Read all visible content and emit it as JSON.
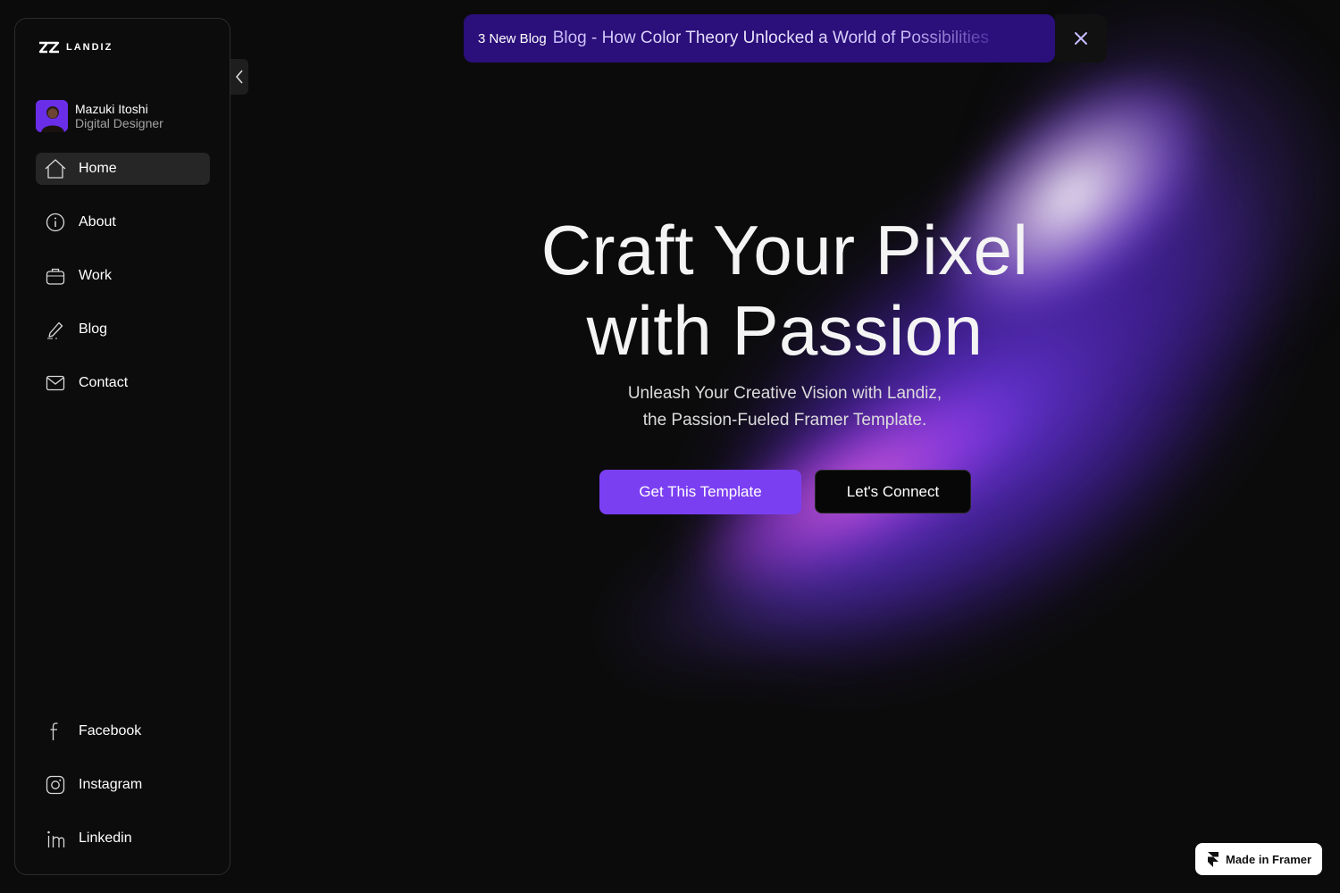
{
  "brand": {
    "logo_mark": "LZ",
    "logo_text": "LANDIZ"
  },
  "profile": {
    "name": "Mazuki Itoshi",
    "role": "Digital Designer"
  },
  "nav": {
    "items": [
      {
        "label": "Home",
        "icon": "home-icon",
        "active": true
      },
      {
        "label": "About",
        "icon": "info-icon",
        "active": false
      },
      {
        "label": "Work",
        "icon": "briefcase-icon",
        "active": false
      },
      {
        "label": "Blog",
        "icon": "pen-icon",
        "active": false
      },
      {
        "label": "Contact",
        "icon": "mail-icon",
        "active": false
      }
    ]
  },
  "social": {
    "items": [
      {
        "label": "Facebook",
        "icon": "facebook-icon"
      },
      {
        "label": "Instagram",
        "icon": "instagram-icon"
      },
      {
        "label": "Linkedin",
        "icon": "linkedin-icon"
      }
    ]
  },
  "banner": {
    "tag": "3 New Blog",
    "text": "Blog - How Color Theory Unlocked a World of Possibilities",
    "close_icon": "close-icon"
  },
  "hero": {
    "title_line1": "Craft Your Pixel",
    "title_line2": "with Passion",
    "subtitle_line1": "Unleash Your Creative Vision with Landiz,",
    "subtitle_line2": "the Passion-Fueled Framer Template.",
    "primary_cta": "Get This Template",
    "secondary_cta": "Let's Connect"
  },
  "badge": {
    "label": "Made in Framer",
    "icon": "framer-icon"
  },
  "colors": {
    "background": "#0b0b0b",
    "accent": "#7b3ff2",
    "banner_bg": "#2b0f7a",
    "active_nav": "#262626"
  }
}
